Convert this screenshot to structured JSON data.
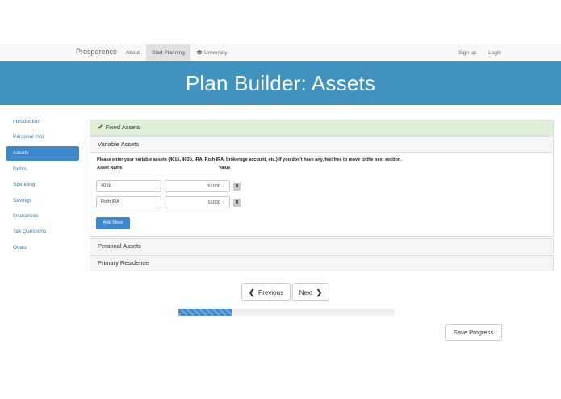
{
  "navbar": {
    "brand": "Prosperence",
    "links": [
      "About",
      "Start Planning",
      "University"
    ],
    "right_links": [
      "Sign up",
      "Login"
    ],
    "active": "Start Planning"
  },
  "header": {
    "title": "Plan Builder: Assets"
  },
  "sidebar": {
    "items": [
      {
        "label": "Introduction"
      },
      {
        "label": "Personal Info"
      },
      {
        "label": "Assets"
      },
      {
        "label": "Debts"
      },
      {
        "label": "Spending"
      },
      {
        "label": "Savings"
      },
      {
        "label": "Insurances"
      },
      {
        "label": "Tax Questions"
      },
      {
        "label": "Goals"
      }
    ],
    "active": "Assets"
  },
  "sections": {
    "fixed": {
      "title": "Fixed Assets",
      "status_icon": "check-icon"
    },
    "variable": {
      "title": "Variable Assets",
      "instructions": "Please enter your variable assets (401k, 403b, IRA, Roth IRA, brokerage account, etc.) If you don't have any, feel free to move to the next section.",
      "col_name": "Asset Name",
      "col_value": "Value",
      "rows": [
        {
          "name": "401k",
          "value": "51000"
        },
        {
          "name": "Roth IRA",
          "value": "16000"
        }
      ],
      "add_more_label": "Add More"
    },
    "personal": {
      "title": "Personal Assets"
    },
    "primary": {
      "title": "Primary Residence"
    }
  },
  "pager": {
    "previous_label": "Previous",
    "next_label": "Next"
  },
  "progress": {
    "fraction": 0.25
  },
  "save_label": "Save Progress",
  "colors": {
    "accent": "#4292bf",
    "primary_button": "#3d87cd",
    "success_bg": "#dff0d8"
  }
}
